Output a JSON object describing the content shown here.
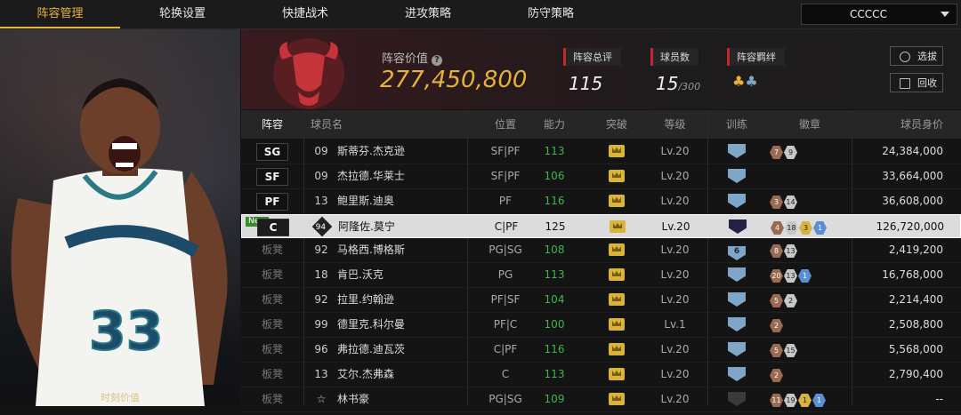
{
  "nav": {
    "tabs": [
      {
        "label": "阵容管理",
        "active": true
      },
      {
        "label": "轮换设置",
        "active": false
      },
      {
        "label": "快捷战术",
        "active": false
      },
      {
        "label": "进攻策略",
        "active": false
      },
      {
        "label": "防守策略",
        "active": false
      }
    ],
    "team_select": "CCCCC"
  },
  "portrait": {
    "moment_label": "时刻价值"
  },
  "team": {
    "logo_text": "CHICAGO BULLS",
    "lineup_value_label": "阵容价值",
    "lineup_value": "277,450,800",
    "overall_label": "阵容总评",
    "overall_value": "115",
    "players_label": "球员数",
    "players_count": "15",
    "players_max": "/300",
    "bond_label": "阵容羁绊",
    "buttons": {
      "select": "选拔",
      "recycle": "回收"
    }
  },
  "table": {
    "headers": [
      "阵容",
      "球员名",
      "位置",
      "能力",
      "突破",
      "等级",
      "训练",
      "徽章",
      "球员身价"
    ],
    "rows": [
      {
        "slot": "SG",
        "num": "09",
        "name": "斯蒂芬.杰克逊",
        "pos": "SF|PF",
        "ability": "113",
        "level": "Lv.20",
        "training": "",
        "badges": [
          {
            "t": "bronze",
            "v": "7"
          },
          {
            "t": "silver",
            "v": "9"
          }
        ],
        "value": "24,384,000"
      },
      {
        "slot": "SF",
        "num": "09",
        "name": "杰拉德.华莱士",
        "pos": "SF|PF",
        "ability": "106",
        "level": "Lv.20",
        "training": "",
        "badges": [],
        "value": "33,664,000"
      },
      {
        "slot": "PF",
        "num": "13",
        "name": "鲍里斯.迪奥",
        "pos": "PF",
        "ability": "116",
        "level": "Lv.20",
        "training": "",
        "badges": [
          {
            "t": "bronze",
            "v": "3"
          },
          {
            "t": "silver",
            "v": "14"
          }
        ],
        "value": "36,608,000"
      },
      {
        "slot": "C",
        "num": "94",
        "name": "阿隆佐.莫宁",
        "pos": "C|PF",
        "ability": "125",
        "level": "Lv.20",
        "training": "",
        "badges": [
          {
            "t": "bronze",
            "v": "4"
          },
          {
            "t": "silver",
            "v": "18"
          },
          {
            "t": "gold",
            "v": "3"
          },
          {
            "t": "blue",
            "v": "1"
          }
        ],
        "value": "126,720,000",
        "selected": true,
        "new": "New"
      },
      {
        "slot": "板凳",
        "num": "92",
        "name": "马格西.博格斯",
        "pos": "PG|SG",
        "ability": "108",
        "level": "Lv.20",
        "training": "6",
        "badges": [
          {
            "t": "bronze",
            "v": "8"
          },
          {
            "t": "silver",
            "v": "13"
          }
        ],
        "value": "2,419,200"
      },
      {
        "slot": "板凳",
        "num": "18",
        "name": "肯巴.沃克",
        "pos": "PG",
        "ability": "113",
        "level": "Lv.20",
        "training": "",
        "badges": [
          {
            "t": "bronze",
            "v": "20"
          },
          {
            "t": "silver",
            "v": "13"
          },
          {
            "t": "blue",
            "v": "1"
          }
        ],
        "value": "16,768,000"
      },
      {
        "slot": "板凳",
        "num": "92",
        "name": "拉里.约翰逊",
        "pos": "PF|SF",
        "ability": "104",
        "level": "Lv.20",
        "training": "",
        "badges": [
          {
            "t": "bronze",
            "v": "5"
          },
          {
            "t": "silver",
            "v": "2"
          }
        ],
        "value": "2,214,400"
      },
      {
        "slot": "板凳",
        "num": "99",
        "name": "德里克.科尔曼",
        "pos": "PF|C",
        "ability": "100",
        "level": "Lv.1",
        "training": "",
        "badges": [
          {
            "t": "bronze",
            "v": "2"
          }
        ],
        "value": "2,508,800"
      },
      {
        "slot": "板凳",
        "num": "96",
        "name": "弗拉德.迪瓦茨",
        "pos": "C|PF",
        "ability": "116",
        "level": "Lv.20",
        "training": "",
        "badges": [
          {
            "t": "bronze",
            "v": "5"
          },
          {
            "t": "silver",
            "v": "15"
          }
        ],
        "value": "5,568,000"
      },
      {
        "slot": "板凳",
        "num": "13",
        "name": "艾尔.杰弗森",
        "pos": "C",
        "ability": "113",
        "level": "Lv.20",
        "training": "",
        "badges": [
          {
            "t": "bronze",
            "v": "2"
          }
        ],
        "value": "2,790,400"
      },
      {
        "slot": "板凳",
        "num": "",
        "name": "林书豪",
        "pos": "PG|SG",
        "ability": "109",
        "level": "Lv.20",
        "training": "",
        "badges": [
          {
            "t": "bronze",
            "v": "11"
          },
          {
            "t": "silver",
            "v": "19"
          },
          {
            "t": "gold",
            "v": "1"
          },
          {
            "t": "blue",
            "v": "1"
          }
        ],
        "value": "--"
      }
    ]
  },
  "colors": {
    "accent": "#e6b23a",
    "ability": "#3fb54a",
    "red_marker": "#c1272d"
  }
}
